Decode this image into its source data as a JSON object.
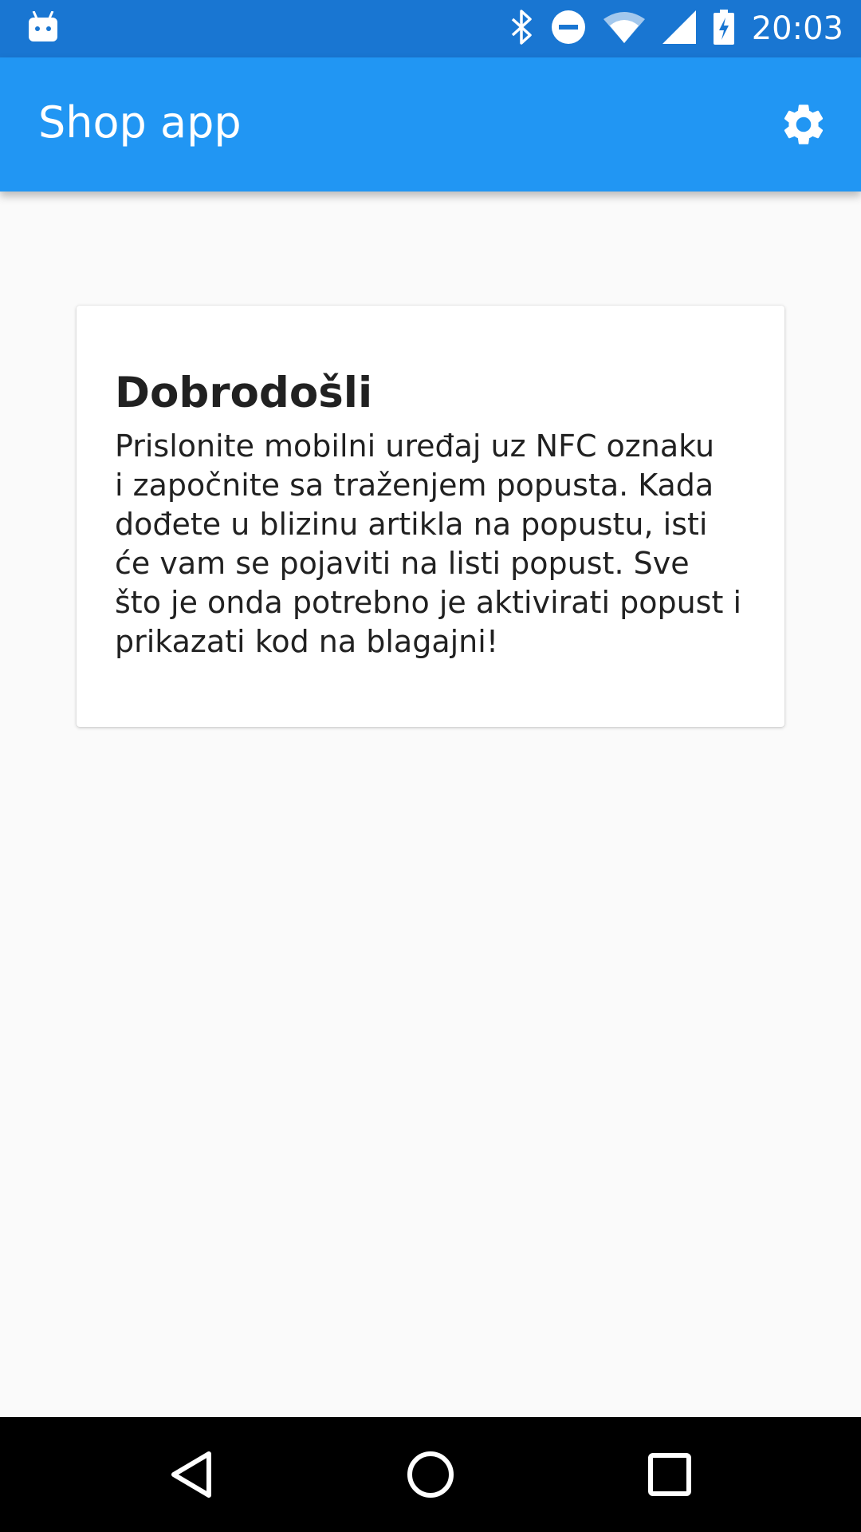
{
  "status_bar": {
    "time": "20:03",
    "icons": [
      "android-debug-icon",
      "bluetooth-icon",
      "do-not-disturb-icon",
      "wifi-icon",
      "signal-icon",
      "battery-charging-icon"
    ],
    "bg_color": "#1976d2"
  },
  "app_bar": {
    "title": "Shop app",
    "action_icon": "settings-icon",
    "bg_color": "#2196f3"
  },
  "card": {
    "title": "Dobrodošli",
    "body_lines": [
      "Prislonite mobilni uređaj uz NFC oznaku",
      "i započnite sa traženjem popusta. Kada",
      "dođete u blizinu artikla na popustu, isti",
      "će vam se pojaviti na listi popust. Sve",
      "što je onda potrebno je aktivirati popust i",
      "prikazati kod na blagajni!"
    ]
  },
  "nav_bar": {
    "buttons": [
      "back-icon",
      "home-icon",
      "recents-icon"
    ]
  }
}
